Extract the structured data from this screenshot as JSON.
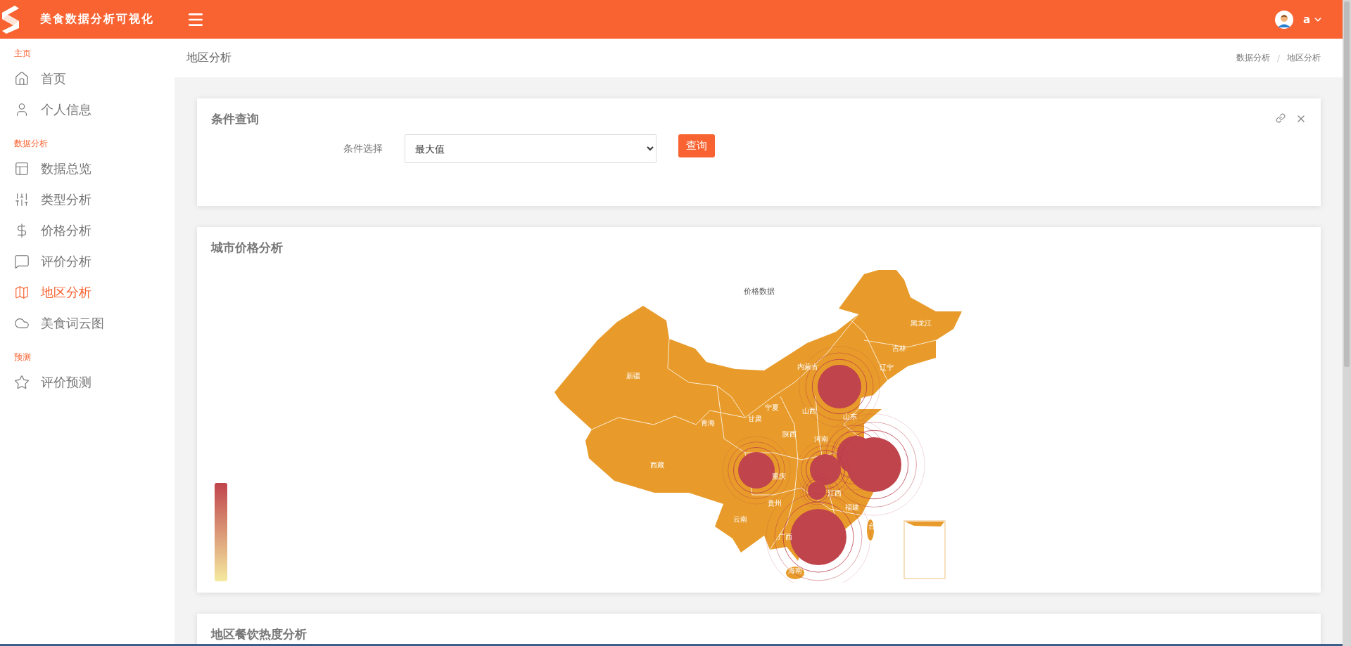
{
  "app": {
    "title": "美食数据分析可视化",
    "user": "a"
  },
  "sidebar": {
    "sections": [
      {
        "label": "主页",
        "items": [
          {
            "label": "首页",
            "selected": false
          },
          {
            "label": "个人信息",
            "selected": false
          }
        ]
      },
      {
        "label": "数据分析",
        "items": [
          {
            "label": "数据总览",
            "selected": false
          },
          {
            "label": "类型分析",
            "selected": false
          },
          {
            "label": "价格分析",
            "selected": false
          },
          {
            "label": "评价分析",
            "selected": false
          },
          {
            "label": "地区分析",
            "selected": true
          },
          {
            "label": "美食词云图",
            "selected": false
          }
        ]
      },
      {
        "label": "预测",
        "items": [
          {
            "label": "评价预测",
            "selected": false
          }
        ]
      }
    ]
  },
  "page": {
    "title": "地区分析",
    "breadcrumb": [
      "数据分析",
      "地区分析"
    ],
    "breadcrumb_separator": "/"
  },
  "query_card": {
    "title": "条件查询",
    "field_label": "条件选择",
    "select_value": "最大值",
    "button": "查询"
  },
  "map_card": {
    "title": "城市价格分析",
    "map_title": "价格数据",
    "province_labels": [
      "新疆",
      "西藏",
      "青海",
      "甘肃",
      "宁夏",
      "内蒙古",
      "山西",
      "山东",
      "陕西",
      "河南",
      "重庆",
      "贵州",
      "云南",
      "广西",
      "海南",
      "江西",
      "福建",
      "黑龙江",
      "吉林",
      "辽宁",
      "台"
    ]
  },
  "heat_card": {
    "title": "地区餐饮热度分析"
  }
}
